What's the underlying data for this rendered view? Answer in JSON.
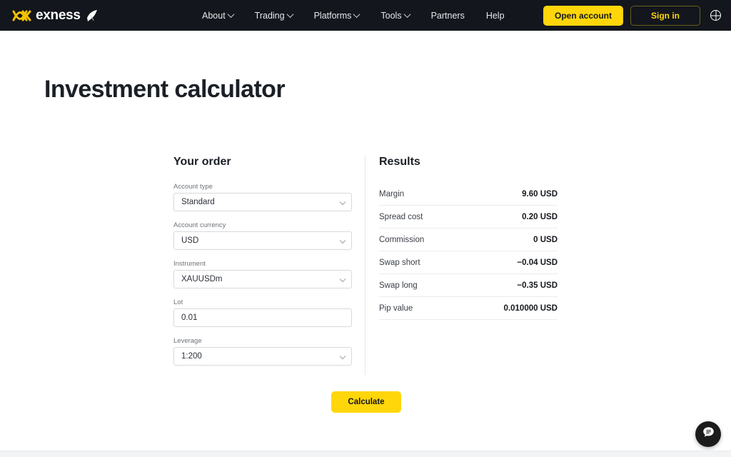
{
  "header": {
    "logo_text": "exness",
    "nav": [
      {
        "label": "About",
        "has_chevron": true
      },
      {
        "label": "Trading",
        "has_chevron": true
      },
      {
        "label": "Platforms",
        "has_chevron": true
      },
      {
        "label": "Tools",
        "has_chevron": true
      },
      {
        "label": "Partners",
        "has_chevron": false
      },
      {
        "label": "Help",
        "has_chevron": false
      }
    ],
    "open_account_label": "Open account",
    "sign_in_label": "Sign in",
    "language_icon": "globe-icon",
    "background_color": "#13161c",
    "accent_color": "#ffd60a"
  },
  "page_title": "Investment calculator",
  "order": {
    "section_title": "Your order",
    "fields": [
      {
        "label": "Account type",
        "value": "Standard",
        "type": "select"
      },
      {
        "label": "Account currency",
        "value": "USD",
        "type": "select"
      },
      {
        "label": "Instrument",
        "value": "XAUUSDm",
        "type": "select"
      },
      {
        "label": "Lot",
        "value": "0.01",
        "type": "text"
      },
      {
        "label": "Leverage",
        "value": "1:200",
        "type": "select"
      }
    ]
  },
  "results": {
    "section_title": "Results",
    "rows": [
      {
        "label": "Margin",
        "value": "9.60 USD"
      },
      {
        "label": "Spread cost",
        "value": "0.20 USD"
      },
      {
        "label": "Commission",
        "value": "0 USD"
      },
      {
        "label": "Swap short",
        "value": "−0.04 USD"
      },
      {
        "label": "Swap long",
        "value": "−0.35 USD"
      },
      {
        "label": "Pip value",
        "value": "0.010000 USD"
      }
    ]
  },
  "calculate_label": "Calculate",
  "chat_widget": {
    "icon": "chat-bubble-icon"
  }
}
